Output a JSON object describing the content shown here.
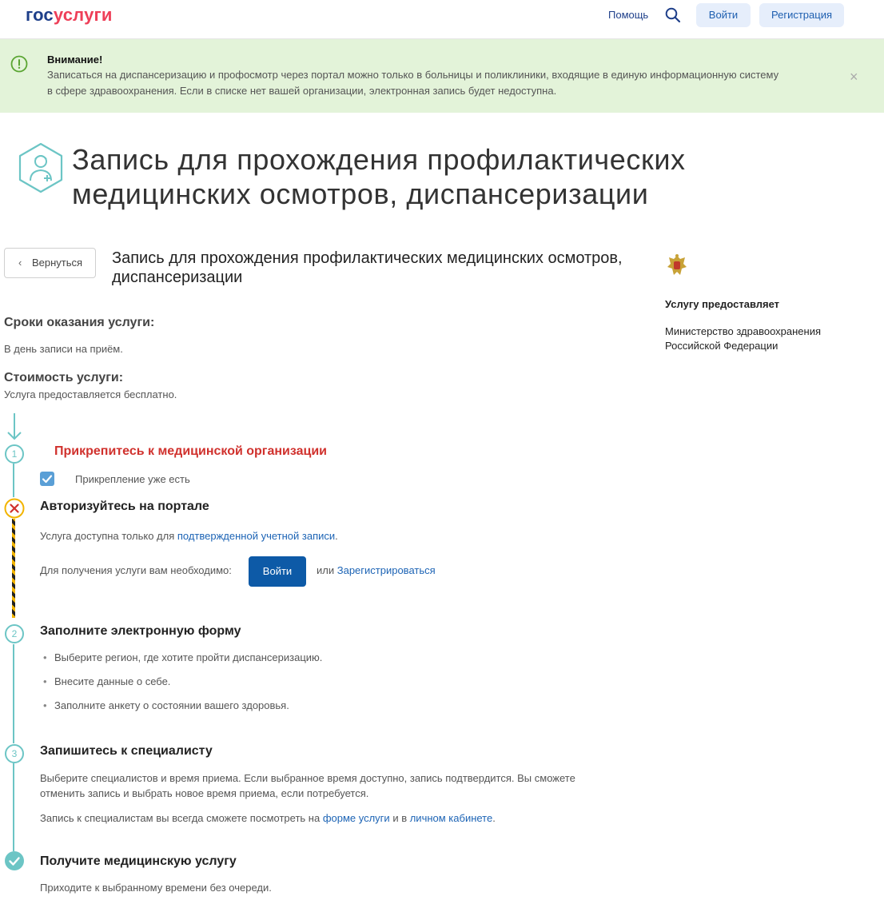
{
  "header": {
    "logo_part1": "гос",
    "logo_part2": "услуги",
    "help": "Помощь",
    "login": "Войти",
    "register": "Регистрация"
  },
  "alert": {
    "title": "Внимание!",
    "text": "Записаться на диспансеризацию и профосмотр через портал можно только в больницы и поликлиники, входящие в единую информационную систему в сфере здравоохранения. Если в списке нет вашей организации, электронная запись будет недоступна.",
    "close": "×"
  },
  "page": {
    "title": "Запись для прохождения профилактических медицинских осмотров, диспансеризации",
    "back": "Вернуться",
    "subtitle": "Запись для прохождения профилактических медицинских осмотров, диспансеризации"
  },
  "provider": {
    "label": "Услугу предоставляет",
    "name": "Министерство здравоохранения Российской Федерации"
  },
  "terms": {
    "heading": "Сроки оказания услуги:",
    "text": "В день записи на приём."
  },
  "cost": {
    "heading": "Стоимость услуги:",
    "text": "Услуга предоставляется бесплатно."
  },
  "steps": {
    "attach": {
      "number": "1",
      "title": "Прикрепитесь к медицинской организации",
      "checkbox_label": "Прикрепление уже есть",
      "checked": true
    },
    "auth": {
      "title": "Авторизуйтесь на портале",
      "text_prefix": "Услуга доступна только для ",
      "text_link": "подтвержденной учетной записи",
      "text_suffix": ".",
      "need_text": "Для получения услуги вам необходимо:",
      "login_button": "Войти",
      "or_text": "или ",
      "register_link": "Зарегистрироваться"
    },
    "form": {
      "number": "2",
      "title": "Заполните электронную форму",
      "items": [
        "Выберите регион, где хотите пройти диспансеризацию.",
        "Внесите данные о себе.",
        "Заполните анкету о состоянии вашего здоровья."
      ]
    },
    "specialist": {
      "number": "3",
      "title": "Запишитесь к специалисту",
      "text1": "Выберите специалистов и время приема. Если выбранное время доступно, запись подтвердится. Вы сможете отменить запись и выбрать новое время приема, если потребуется.",
      "text2_prefix": "Запись к специалистам вы всегда сможете посмотреть на ",
      "text2_link1": "форме услуги",
      "text2_mid": " и в ",
      "text2_link2": "личном кабинете",
      "text2_suffix": "."
    },
    "receive": {
      "title": "Получите медицинскую услугу",
      "text": "Приходите к выбранному времени без очереди."
    }
  },
  "colors": {
    "brand_blue": "#1e3f8a",
    "brand_red": "#ee3f58",
    "alert_bg": "#e3f3d9",
    "teal": "#6cc5c5",
    "link": "#1d64b5",
    "primary_button": "#0d5aa7",
    "error": "#d0312d"
  }
}
